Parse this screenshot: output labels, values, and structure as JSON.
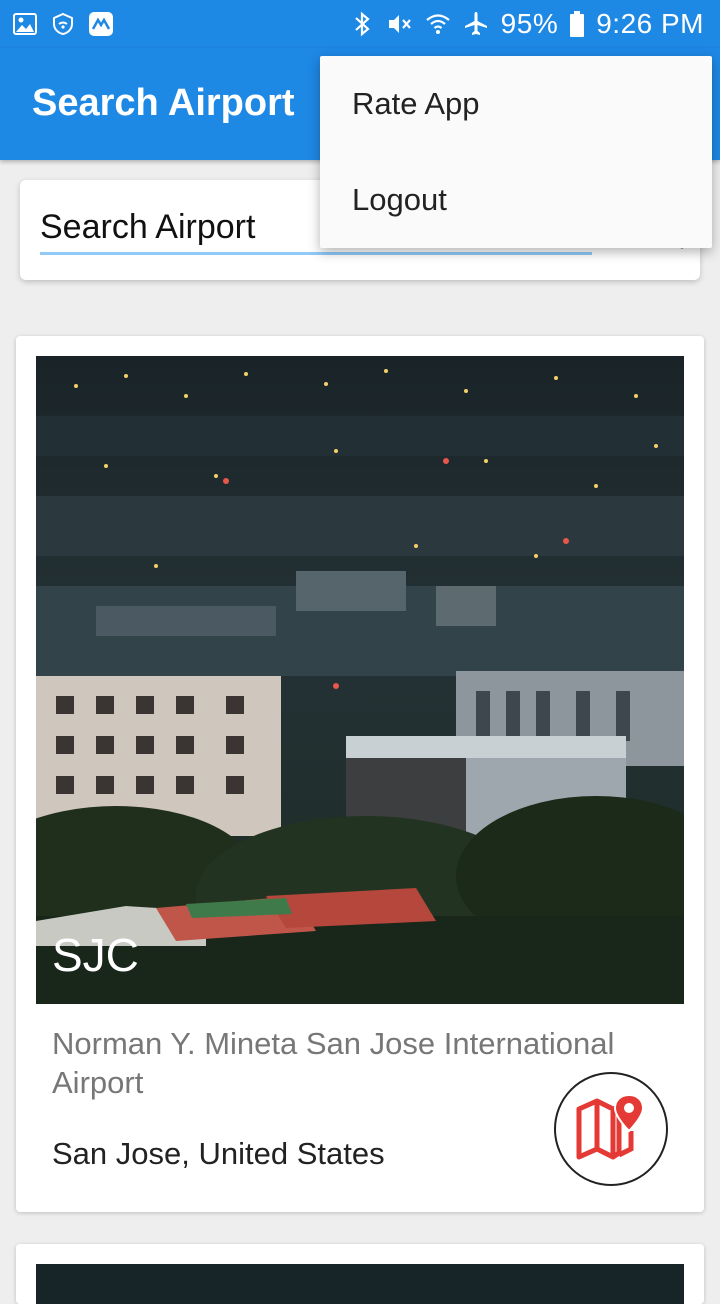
{
  "status_bar": {
    "battery": "95%",
    "time": "9:26 PM",
    "icons_left": [
      "gallery-icon",
      "wifi-shield-icon",
      "app-icon"
    ],
    "icons_right": [
      "bluetooth-icon",
      "mute-icon",
      "wifi-icon",
      "airplane-icon",
      "battery-icon"
    ]
  },
  "app_bar": {
    "title": "Search Airport"
  },
  "search": {
    "value": "Search Airport"
  },
  "airports": [
    {
      "code": "SJC",
      "name": "Norman Y. Mineta San Jose International Airport",
      "location": "San Jose, United States"
    }
  ],
  "menu": {
    "items": [
      "Rate App",
      "Logout"
    ]
  },
  "colors": {
    "primary": "#1e88e5",
    "accent": "#e53935"
  }
}
